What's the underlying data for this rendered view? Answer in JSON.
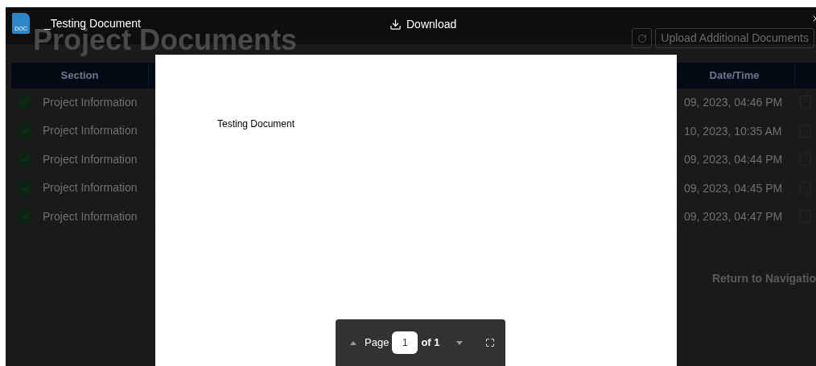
{
  "page": {
    "heading": "Project Documents",
    "upload_button": "Upload Additional Documents",
    "table": {
      "columns": [
        "Section",
        "Date/Time"
      ],
      "rows": [
        {
          "section": "Project Information",
          "date_time": "09, 2023, 04:46 PM"
        },
        {
          "section": "Project Information",
          "date_time": "10, 2023, 10:35 AM"
        },
        {
          "section": "Project Information",
          "date_time": "09, 2023, 04:44 PM"
        },
        {
          "section": "Project Information",
          "date_time": "09, 2023, 04:45 PM"
        },
        {
          "section": "Project Information",
          "date_time": "09, 2023, 04:47 PM"
        }
      ]
    },
    "return_link": "Return to Navigatio"
  },
  "viewer": {
    "file_type": "DOC",
    "title": "_Testing Document",
    "download": "Download",
    "document_text": "Testing Document",
    "pager": {
      "label": "Page",
      "page": "1",
      "total": "of 1"
    }
  }
}
